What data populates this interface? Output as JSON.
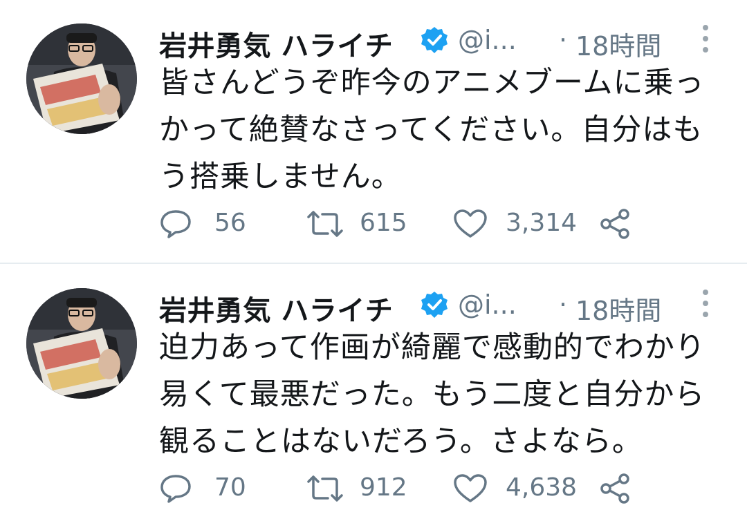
{
  "colors": {
    "text": "#14171a",
    "muted": "#657786",
    "verified": "#1da1f2",
    "divider": "#e6ecf0"
  },
  "tweets": [
    {
      "author": {
        "name": "岩井勇気 ハライチ",
        "handle": "@i...",
        "verified": true
      },
      "separator": "·",
      "time": "18時間",
      "lines": [
        "皆さんどうぞ昨今のアニメブームに乗っ",
        "かって絶賛なさってください。自分はも",
        "う搭乗しません。"
      ],
      "replies": "56",
      "retweets": "615",
      "likes": "3,314"
    },
    {
      "author": {
        "name": "岩井勇気 ハライチ",
        "handle": "@i...",
        "verified": true
      },
      "separator": "·",
      "time": "18時間",
      "lines": [
        "迫力あって作画が綺麗で感動的でわかり",
        "易くて最悪だった。もう二度と自分から",
        "観ることはないだろう。さよなら。"
      ],
      "replies": "70",
      "retweets": "912",
      "likes": "4,638"
    }
  ]
}
